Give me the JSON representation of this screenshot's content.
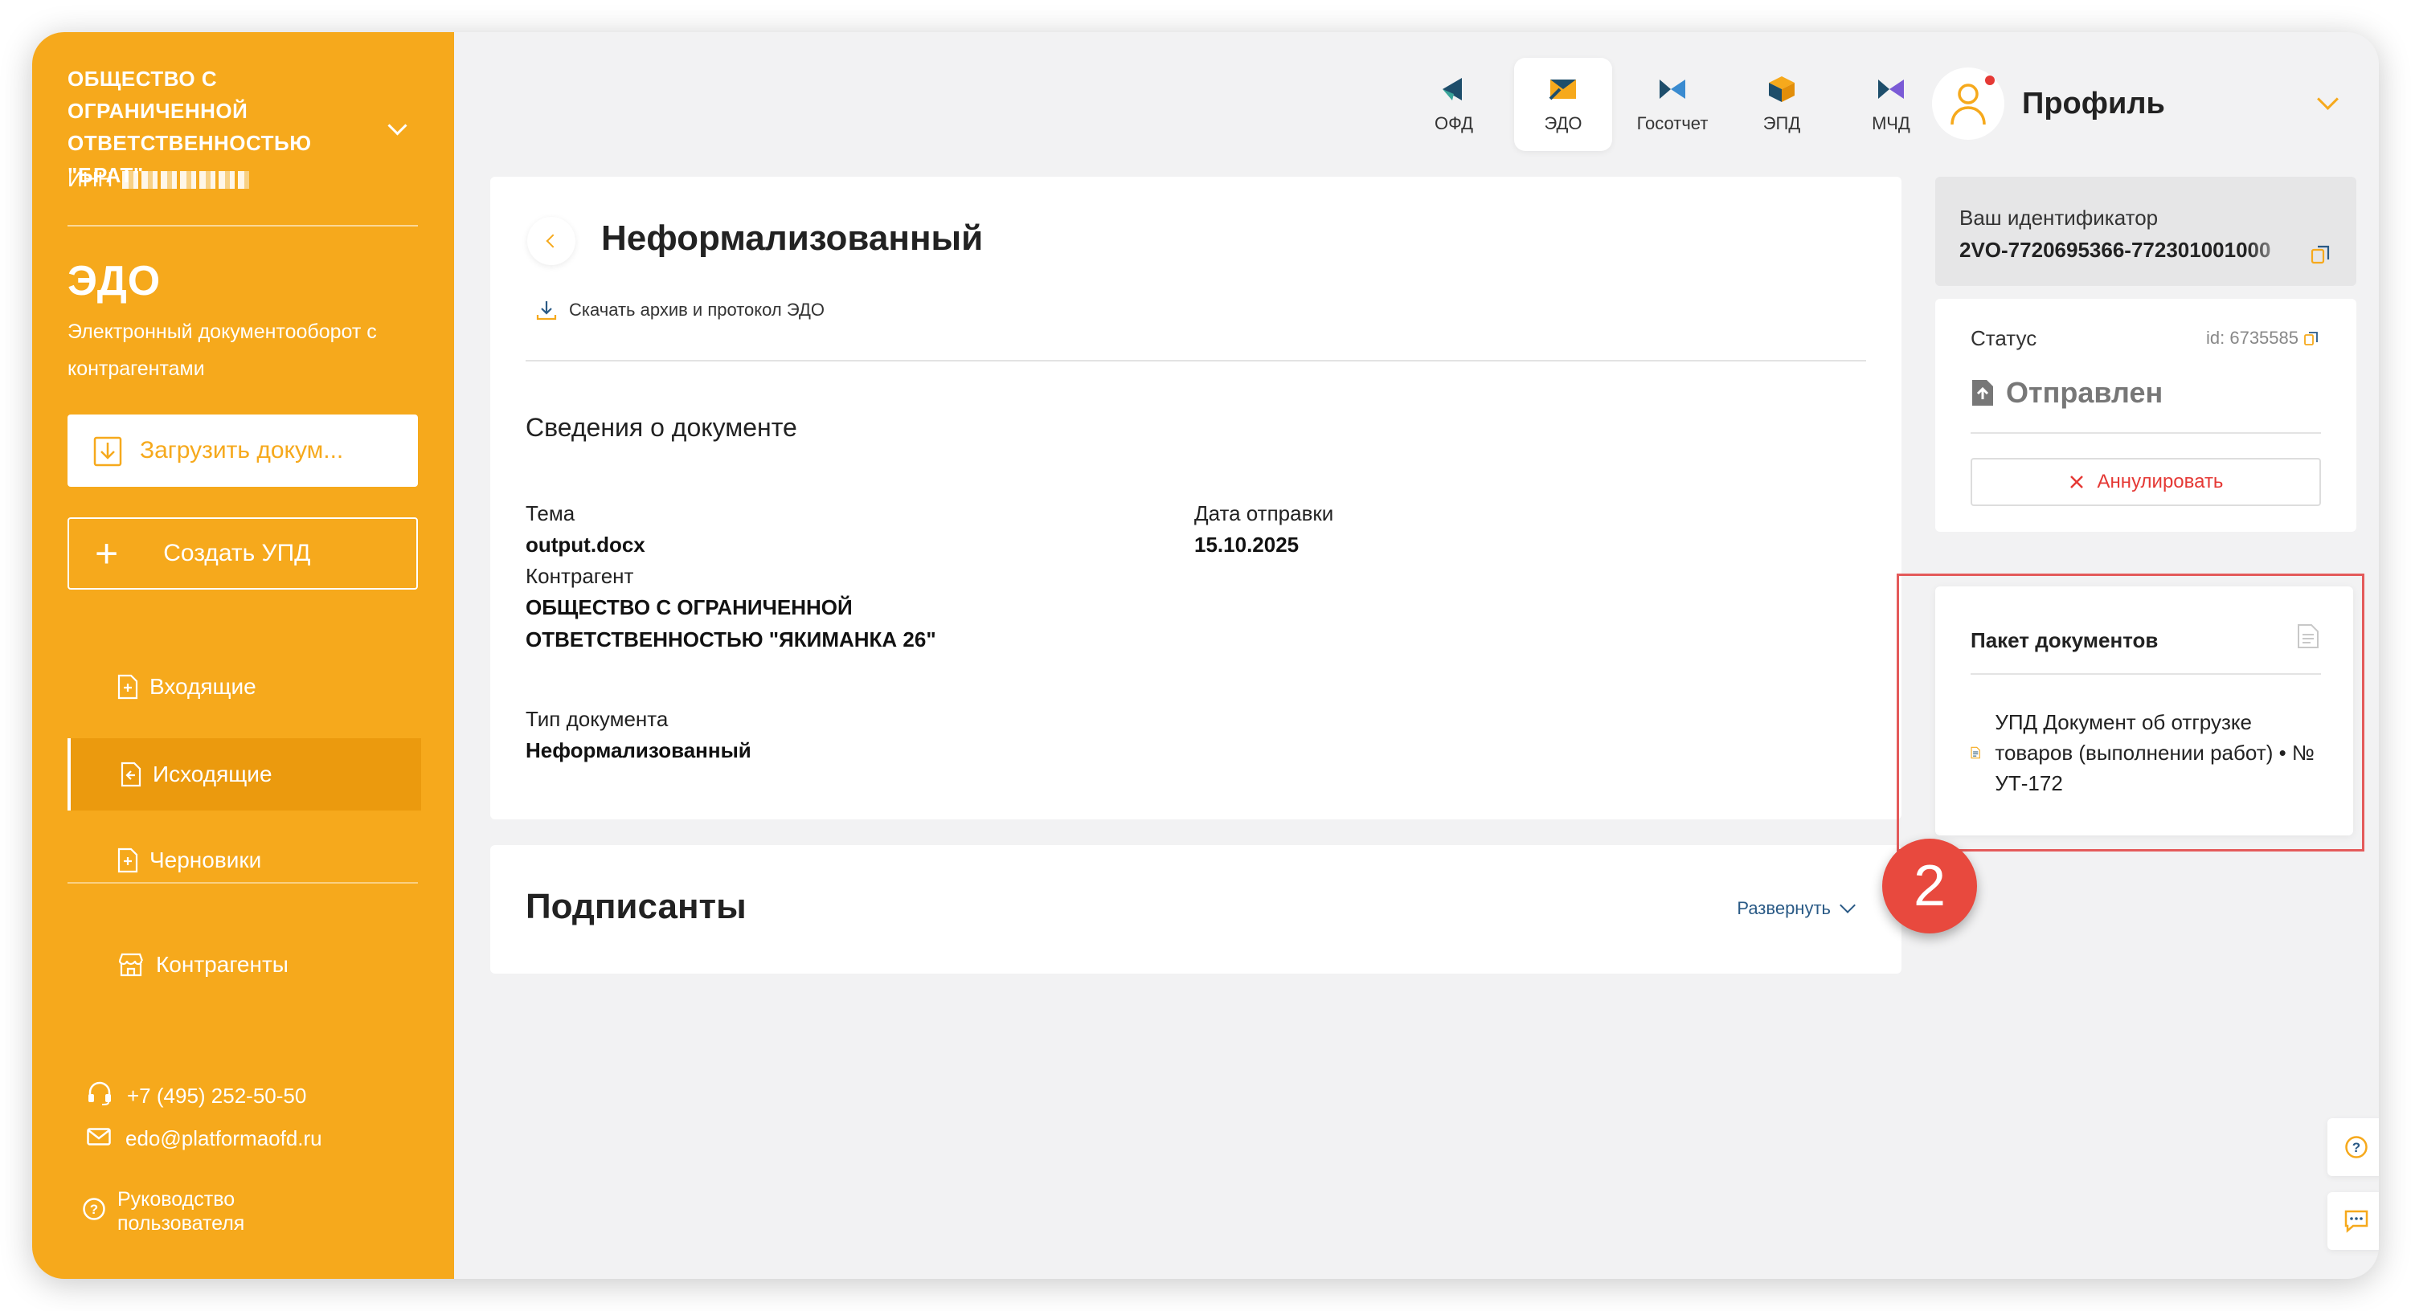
{
  "sidebar": {
    "org_name": "ОБЩЕСТВО С ОГРАНИЧЕННОЙ ОТВЕТСТВЕННОСТЬЮ \"БРАТ\"",
    "inn_label": "ИНН",
    "section_title": "ЭДО",
    "section_subtitle": "Электронный документооборот с контрагентами",
    "upload_label": "Загрузить докум...",
    "create_label": "Создать УПД",
    "nav": [
      {
        "label": "Входящие",
        "icon": "document-icon"
      },
      {
        "label": "Исходящие",
        "icon": "document-icon",
        "active": true
      },
      {
        "label": "Черновики",
        "icon": "document-icon"
      },
      {
        "label": "Контрагенты",
        "icon": "store-icon"
      }
    ],
    "phone": "+7 (495) 252-50-50",
    "email": "edo@platformaofd.ru",
    "guide_label": "Руководство пользователя"
  },
  "tabs": [
    {
      "label": "ОФД"
    },
    {
      "label": "ЭДО",
      "active": true
    },
    {
      "label": "Госотчет"
    },
    {
      "label": "ЭПД"
    },
    {
      "label": "МЧД"
    }
  ],
  "profile": {
    "label": "Профиль"
  },
  "document": {
    "title": "Неформализованный",
    "download_label": "Скачать архив и протокол ЭДО",
    "info_title": "Сведения о документе",
    "subject_label": "Тема",
    "subject_value": "output.docx",
    "sent_date_label": "Дата отправки",
    "sent_date_value": "15.10.2025",
    "counterparty_label": "Контрагент",
    "counterparty_value": "ОБЩЕСТВО С ОГРАНИЧЕННОЙ ОТВЕТСТВЕННОСТЬЮ \"ЯКИМАНКА 26\"",
    "doc_type_label": "Тип документа",
    "doc_type_value": "Неформализованный"
  },
  "signers": {
    "title": "Подписанты",
    "expand_label": "Развернуть"
  },
  "identifier": {
    "label": "Ваш идентификатор",
    "value": "2VO-7720695366-772301001000"
  },
  "status": {
    "label": "Статус",
    "id_text": "id: 6735585",
    "value": "Отправлен",
    "annul_label": "Аннулировать"
  },
  "package": {
    "title": "Пакет документов",
    "item_text": "УПД Документ об отгрузке товаров (выполнении работ) • № УТ-172"
  },
  "badge": {
    "number": "2"
  },
  "colors": {
    "accent": "#f6a91c",
    "danger": "#e53935",
    "highlight": "#e45a5a"
  }
}
